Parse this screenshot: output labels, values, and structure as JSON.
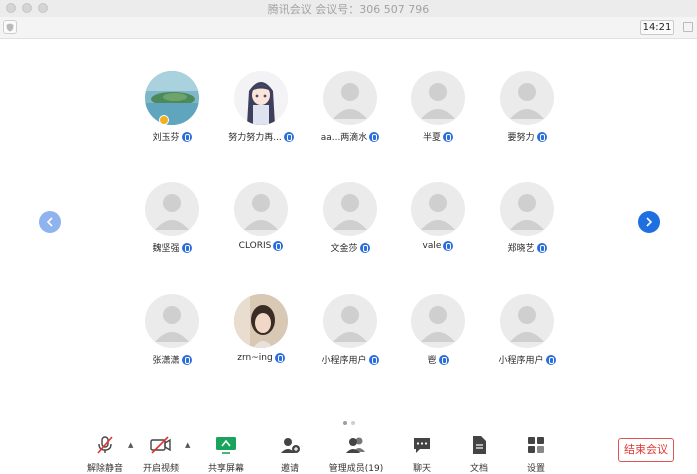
{
  "window": {
    "title": "腾讯会议 会议号：306 507 796",
    "timer": "14:21"
  },
  "participants": [
    {
      "name": "刘玉芬",
      "avatar": "landscape-photo",
      "host": true
    },
    {
      "name": "努力努力再...",
      "avatar": "anime-girl"
    },
    {
      "name": "aa...两滴水",
      "avatar": "default"
    },
    {
      "name": "半夏",
      "avatar": "default"
    },
    {
      "name": "要努力",
      "avatar": "default"
    },
    {
      "name": "魏坚强",
      "avatar": "default"
    },
    {
      "name": "CLORIS",
      "avatar": "default"
    },
    {
      "name": "文金莎",
      "avatar": "default"
    },
    {
      "name": "vale",
      "avatar": "default"
    },
    {
      "name": "郑晓艺",
      "avatar": "default"
    },
    {
      "name": "张潇潇",
      "avatar": "default"
    },
    {
      "name": "zrn~ing",
      "avatar": "girl-photo"
    },
    {
      "name": "小程序用户",
      "avatar": "default"
    },
    {
      "name": "鬯",
      "avatar": "default"
    },
    {
      "name": "小程序用户",
      "avatar": "default"
    }
  ],
  "controls": {
    "unmute": "解除静音",
    "start_video": "开启视频",
    "share_screen": "共享屏幕",
    "invite": "邀请",
    "manage_members": "管理成员(19)",
    "chat": "聊天",
    "docs": "文档",
    "settings": "设置",
    "end_meeting": "结束会议"
  },
  "colors": {
    "accent": "#1e6fe0",
    "mic_badge": "#2a6fd9",
    "end_red": "#e03434",
    "share_green": "#1aa35a"
  },
  "pager": {
    "current": 1,
    "total": 2
  }
}
